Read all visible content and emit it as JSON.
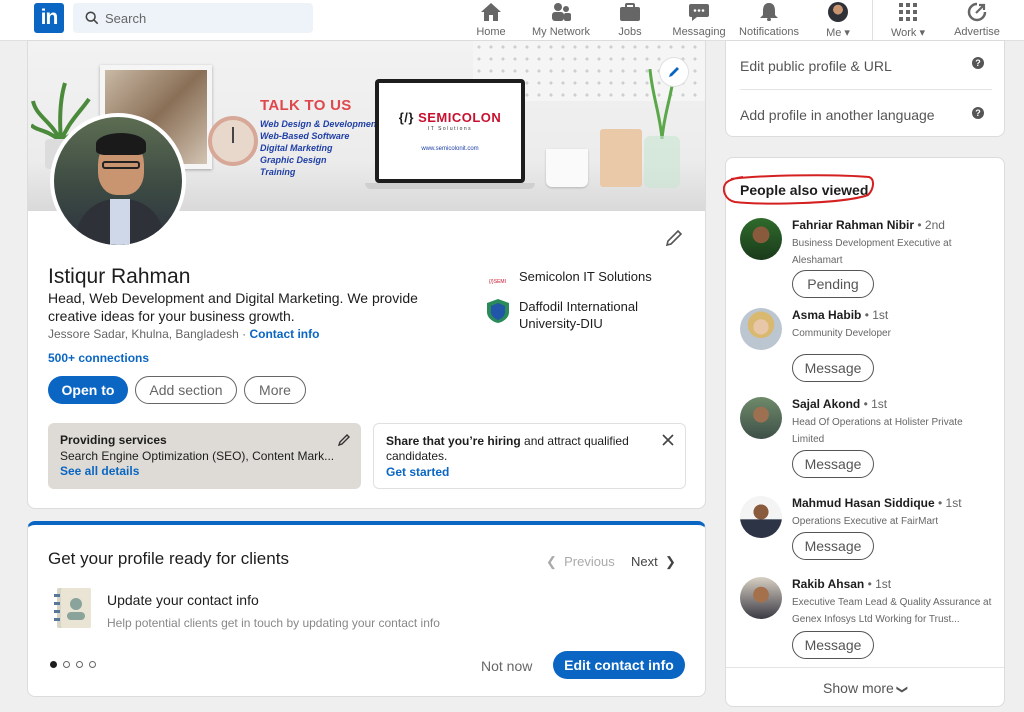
{
  "nav": {
    "logo_text": "in",
    "search_placeholder": "Search",
    "items": [
      {
        "label": "Home",
        "icon": "home-icon"
      },
      {
        "label": "My Network",
        "icon": "network-icon"
      },
      {
        "label": "Jobs",
        "icon": "briefcase-icon"
      },
      {
        "label": "Messaging",
        "icon": "chat-icon"
      },
      {
        "label": "Notifications",
        "icon": "bell-icon"
      },
      {
        "label": "Me",
        "icon": "avatar-icon"
      },
      {
        "label": "Work",
        "icon": "grid-icon"
      },
      {
        "label": "Advertise",
        "icon": "compass-icon"
      }
    ],
    "accent": "#0a66c2"
  },
  "cover": {
    "headline": "TALK TO US",
    "services": [
      "Web Design & Development",
      "Web-Based Software",
      "Digital Marketing",
      "Graphic Design",
      "Training"
    ],
    "brand_prefix": "{/}",
    "brand_name": "SEMICOLON",
    "brand_sub": "IT Solutions",
    "brand_url": "www.semicolonit.com"
  },
  "profile": {
    "name": "Istiqur Rahman",
    "headline": "Head, Web Development and Digital Marketing. We provide creative ideas for your business growth.",
    "location": "Jessore Sadar, Khulna, Bangladesh · ",
    "contact_info": "Contact info",
    "connections": "500+ connections",
    "orgs": [
      {
        "name": "Semicolon IT Solutions"
      },
      {
        "name": "Daffodil International University-DIU"
      }
    ],
    "buttons": {
      "open_to": "Open to",
      "add_section": "Add section",
      "more": "More"
    },
    "services_box": {
      "title": "Providing services",
      "text": "Search Engine Optimization (SEO), Content Mark...",
      "link": "See all details"
    },
    "hiring_box": {
      "bold": "Share that you’re hiring",
      "text": " and attract qualified candidates.",
      "link": "Get started"
    }
  },
  "clients": {
    "title": "Get your profile ready for clients",
    "previous": "Previous",
    "next": "Next",
    "item_title": "Update your contact info",
    "item_desc": "Help potential clients get in touch by updating your contact info",
    "not_now": "Not now",
    "edit_contact": "Edit contact info",
    "pages": 4,
    "current_page": 1
  },
  "right_links": {
    "edit_public": "Edit public profile & URL",
    "add_language": "Add profile in another language"
  },
  "people_also_viewed": {
    "title": "People also viewed",
    "people": [
      {
        "name": "Fahriar Rahman Nibir",
        "degree": " • 2nd",
        "desc": "Business Development Executive at Aleshamart",
        "action": "Pending"
      },
      {
        "name": "Asma Habib",
        "degree": " • 1st",
        "desc": "Community Developer",
        "action": "Message"
      },
      {
        "name": "Sajal Akond",
        "degree": " • 1st",
        "desc": "Head Of Operations at Holister Private Limited",
        "action": "Message"
      },
      {
        "name": "Mahmud Hasan Siddique",
        "degree": " • 1st",
        "desc": "Operations Executive at FairMart",
        "action": "Message"
      },
      {
        "name": "Rakib Ahsan",
        "degree": " • 1st",
        "desc": "Executive Team Lead & Quality Assurance at Genex Infosys Ltd Working for Trust...",
        "action": "Message"
      }
    ],
    "show_more": "Show more"
  }
}
